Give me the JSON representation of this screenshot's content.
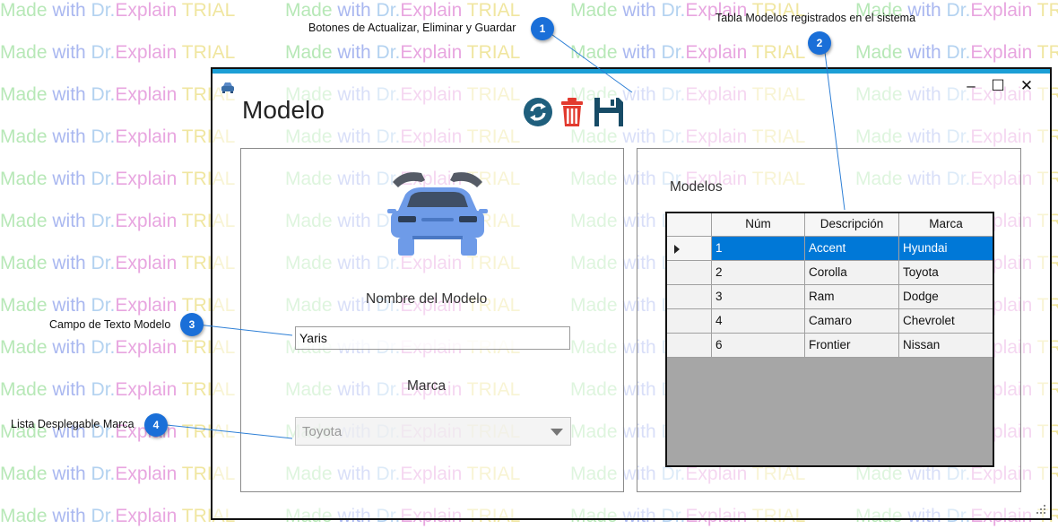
{
  "watermark": {
    "made": "Made",
    "with": " with ",
    "dr": "Dr.",
    "explain": "Explain",
    "trial": " TRIAL"
  },
  "callouts": [
    {
      "number": "1",
      "text": "Botones de Actualizar, Eliminar y Guardar"
    },
    {
      "number": "2",
      "text": "Tabla Modelos registrados en el sistema"
    },
    {
      "number": "3",
      "text": "Campo de Texto Modelo"
    },
    {
      "number": "4",
      "text": "Lista Desplegable Marca"
    }
  ],
  "window": {
    "title": "Modelo",
    "controls": {
      "minimize": "–",
      "maximize": "☐",
      "close": "✕"
    },
    "toolbar": {
      "refresh_icon": "refresh-icon",
      "delete_icon": "trash-icon",
      "save_icon": "floppy-disk-icon"
    },
    "form": {
      "model_label": "Nombre del Modelo",
      "model_value": "Yaris",
      "brand_label": "Marca",
      "brand_selected": "Toyota"
    },
    "table": {
      "title": "Modelos",
      "columns": [
        "Núm",
        "Descripción",
        "Marca"
      ],
      "rows": [
        {
          "num": "1",
          "descripcion": "Accent",
          "marca": "Hyundai",
          "selected": true
        },
        {
          "num": "2",
          "descripcion": "Corolla",
          "marca": "Toyota"
        },
        {
          "num": "3",
          "descripcion": "Ram",
          "marca": "Dodge"
        },
        {
          "num": "4",
          "descripcion": "Camaro",
          "marca": "Chevrolet"
        },
        {
          "num": "6",
          "descripcion": "Frontier",
          "marca": "Nissan"
        }
      ]
    }
  },
  "colors": {
    "accent": "#1c9fd6",
    "selection": "#0078d7",
    "badge": "#1a6fd8",
    "car": "#6e9be8",
    "delete": "#e23a2e",
    "refresh": "#1f5f7d",
    "save": "#174b66"
  }
}
